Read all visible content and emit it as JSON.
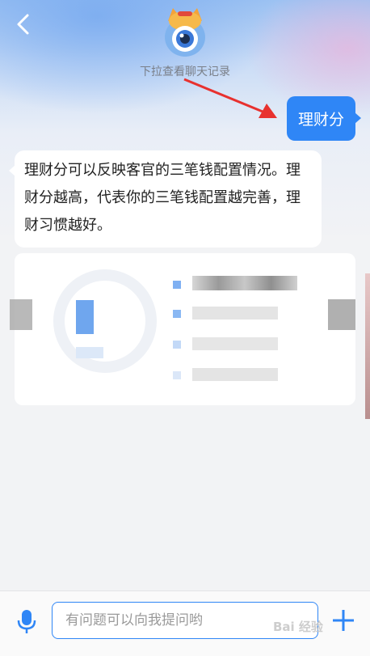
{
  "header": {
    "history_hint": "下拉查看聊天记录"
  },
  "messages": {
    "user": "理财分",
    "bot": "理财分可以反映客官的三笔钱配置情况。理财分越高，代表你的三笔钱配置越完善，理财习惯越好。"
  },
  "input": {
    "placeholder": "有问题可以向我提问哟"
  },
  "watermark": "Bai 经验",
  "icons": {
    "back": "back-chevron-icon",
    "avatar": "mascot-avatar-icon",
    "mic": "microphone-icon",
    "plus": "plus-icon",
    "arrow": "red-arrow-annotation"
  },
  "colors": {
    "accent": "#2f86f6",
    "annotation": "#e8312f"
  }
}
